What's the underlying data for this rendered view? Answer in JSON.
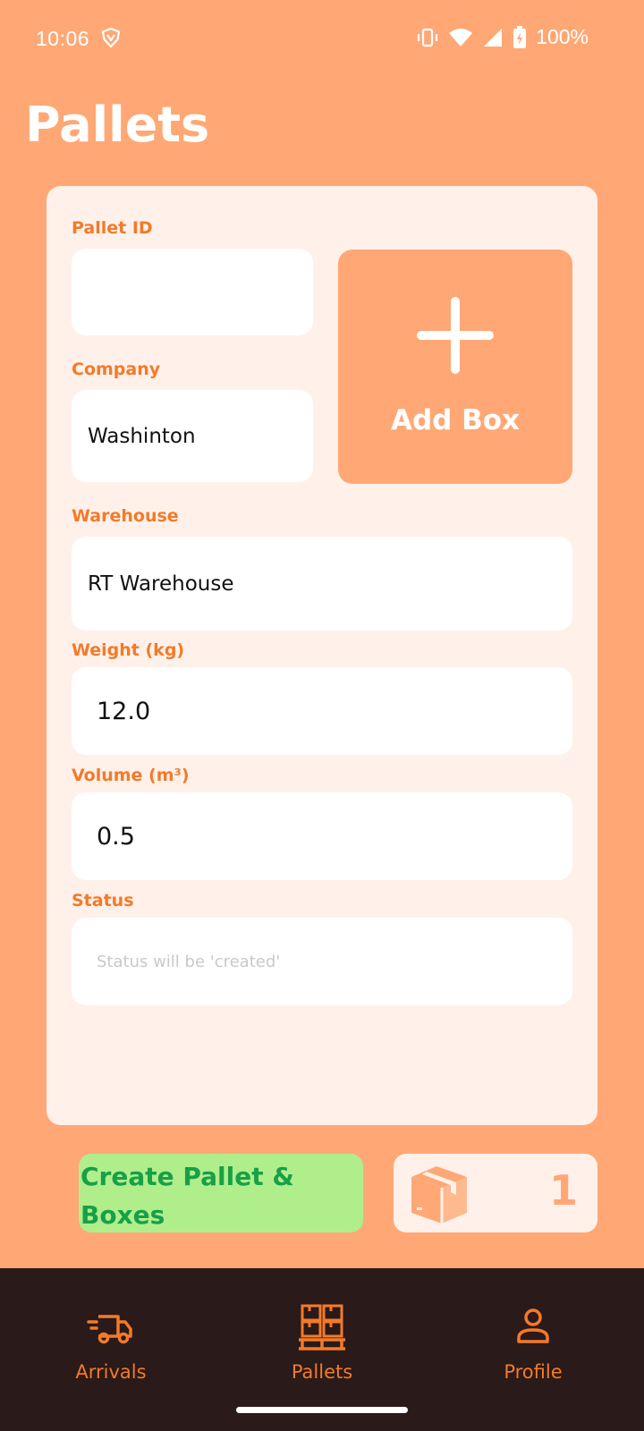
{
  "status_bar": {
    "time": "10:06",
    "battery": "100%"
  },
  "page": {
    "title": "Pallets"
  },
  "form": {
    "pallet_id": {
      "label": "Pallet ID",
      "value": ""
    },
    "company": {
      "label": "Company",
      "value": "Washinton"
    },
    "warehouse": {
      "label": "Warehouse",
      "value": "RT Warehouse"
    },
    "weight": {
      "label": "Weight (kg)",
      "value": "12.0"
    },
    "volume": {
      "label": "Volume (m³)",
      "value": "0.5"
    },
    "status": {
      "label": "Status",
      "placeholder": "Status will be 'created'"
    }
  },
  "add_box": {
    "label": "Add Box",
    "icon": "plus-icon"
  },
  "actions": {
    "create_label": "Create Pallet & Boxes",
    "box_count": "1",
    "box_icon": "box-icon"
  },
  "bottom_nav": {
    "items": [
      {
        "label": "Arrivals",
        "icon": "truck-icon"
      },
      {
        "label": "Pallets",
        "icon": "pallets-icon"
      },
      {
        "label": "Profile",
        "icon": "person-icon"
      }
    ]
  },
  "colors": {
    "background": "#FFA875",
    "card": "#FFF1EA",
    "accent": "#F47A28",
    "create_button": "#B0EE8C",
    "create_text": "#17A047",
    "nav_background": "#2A1A1A"
  }
}
